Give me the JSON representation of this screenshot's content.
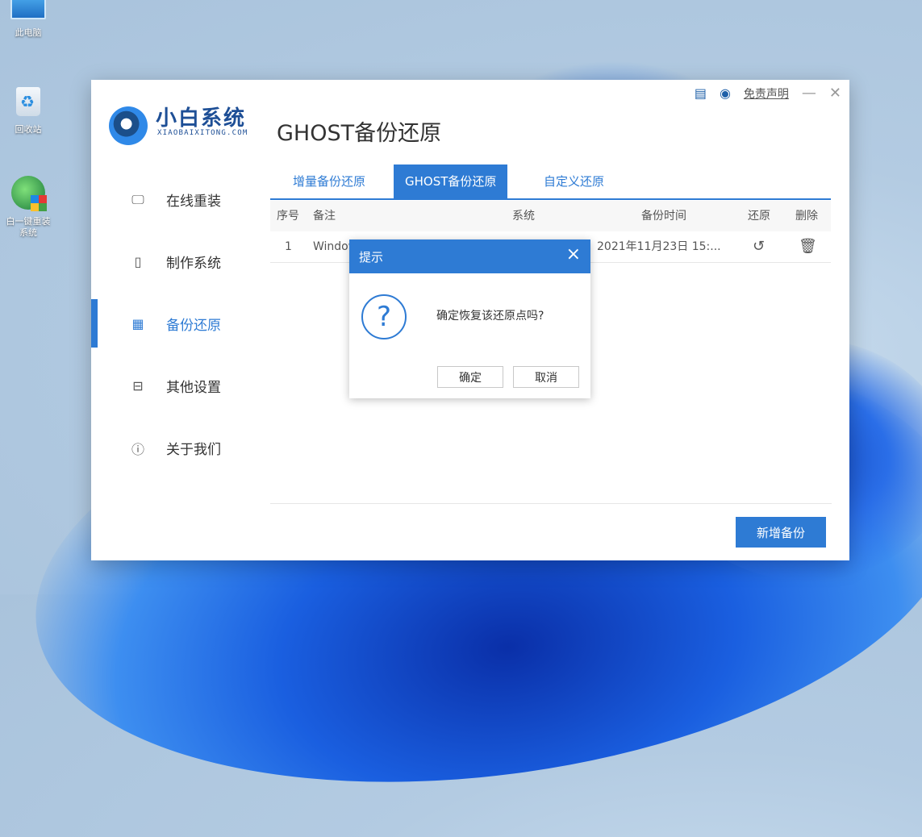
{
  "desktop": {
    "icons": [
      {
        "label": "此电脑",
        "icon": "computer-icon"
      },
      {
        "label": "回收站",
        "icon": "recycle-bin-icon"
      },
      {
        "label": "白一键重装\n系统",
        "icon": "app-shortcut-icon"
      }
    ]
  },
  "app": {
    "brand": "小白系统",
    "brand_sub": "XIAOBAIXITONG.COM",
    "page_title": "GHOST备份还原",
    "disclaimer": "免责声明",
    "toolbar_icons": [
      "feedback-icon",
      "support-icon"
    ]
  },
  "sidebar": {
    "items": [
      {
        "label": "在线重装",
        "icon": "monitor-icon",
        "active": false
      },
      {
        "label": "制作系统",
        "icon": "usb-icon",
        "active": false
      },
      {
        "label": "备份还原",
        "icon": "grid-icon",
        "active": true
      },
      {
        "label": "其他设置",
        "icon": "briefcase-icon",
        "active": false
      },
      {
        "label": "关于我们",
        "icon": "info-icon",
        "active": false
      }
    ]
  },
  "tabs": [
    {
      "label": "增量备份还原",
      "active": false
    },
    {
      "label": "GHOST备份还原",
      "active": true
    },
    {
      "label": "自定义还原",
      "active": false
    }
  ],
  "table": {
    "headers": [
      "序号",
      "备注",
      "系统",
      "备份时间",
      "还原",
      "删除"
    ],
    "rows": [
      {
        "index": "1",
        "note": "Windows",
        "system": "",
        "time": "2021年11月23日 15:...",
        "restore_icon": "restore-icon",
        "delete_icon": "trash-icon"
      }
    ]
  },
  "actions": {
    "new_backup": "新增备份"
  },
  "dialog": {
    "title": "提示",
    "message": "确定恢复该还原点吗?",
    "confirm": "确定",
    "cancel": "取消",
    "icon": "question-icon"
  },
  "colors": {
    "accent": "#2e7bd4",
    "brand": "#1e4f96"
  }
}
